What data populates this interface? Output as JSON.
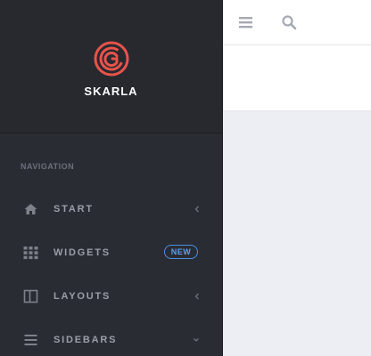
{
  "brand": {
    "name": "SKARLA",
    "accent_color": "#e8534a",
    "logo_icon": "spiral-g-logo"
  },
  "navigation": {
    "heading": "NAVIGATION",
    "items": [
      {
        "label": "START",
        "icon": "home-icon",
        "indicator": "chevron-left"
      },
      {
        "label": "WIDGETS",
        "icon": "grid-icon",
        "badge": "NEW"
      },
      {
        "label": "LAYOUTS",
        "icon": "layout-icon",
        "indicator": "chevron-left"
      },
      {
        "label": "SIDEBARS",
        "icon": "list-icon",
        "indicator": "chevron-down"
      }
    ]
  },
  "topbar": {
    "icons": [
      "menu-icon",
      "search-icon"
    ]
  },
  "colors": {
    "sidebar": "#2a2c33",
    "badge": "#4a90e2",
    "page_background": "#eceef3"
  }
}
